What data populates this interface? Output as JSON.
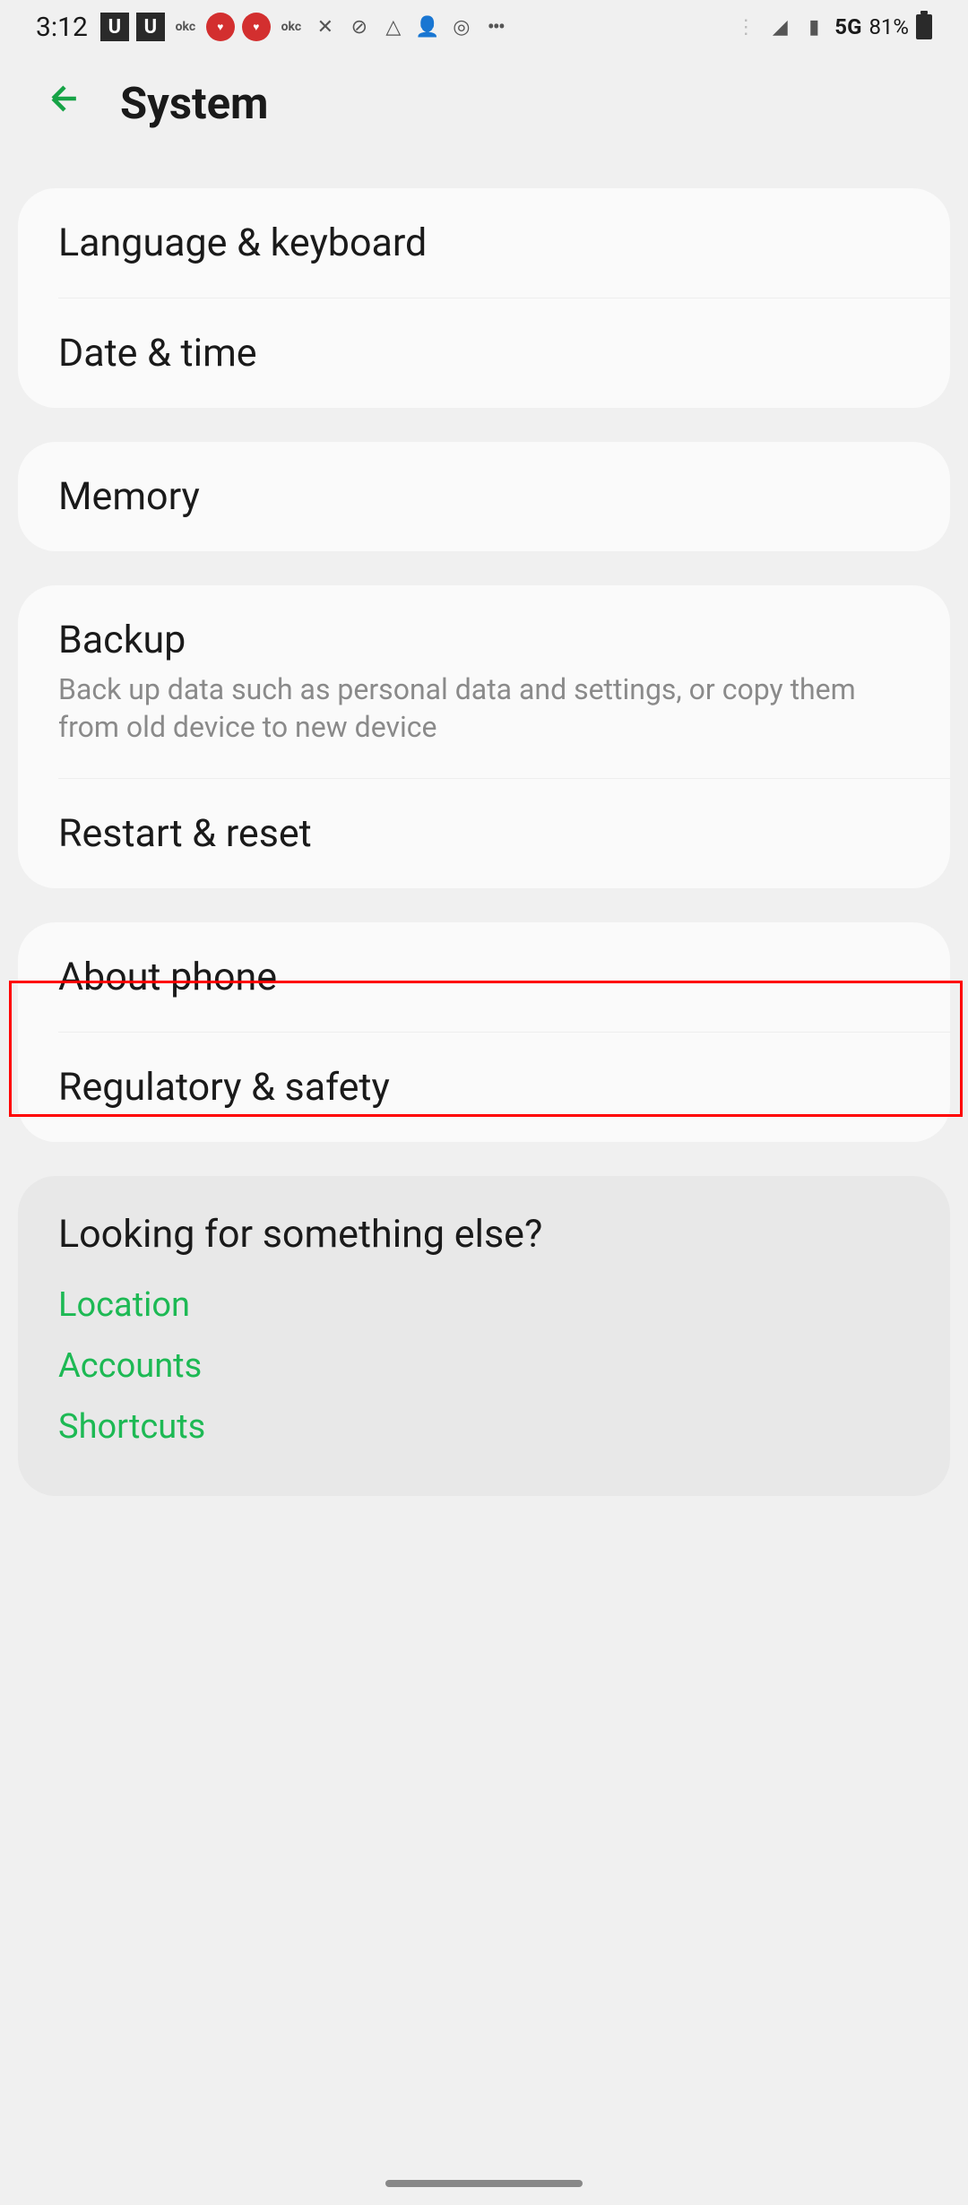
{
  "status": {
    "time": "3:12",
    "network": "5G",
    "battery": "81%"
  },
  "header": {
    "title": "System"
  },
  "items": {
    "language_keyboard": "Language & keyboard",
    "date_time": "Date & time",
    "memory": "Memory",
    "backup": {
      "title": "Backup",
      "subtitle": "Back up data such as personal data and settings, or copy them from old device to new device"
    },
    "restart_reset": "Restart & reset",
    "about_phone": "About phone",
    "regulatory_safety": "Regulatory & safety"
  },
  "suggestions": {
    "title": "Looking for something else?",
    "links": {
      "location": "Location",
      "accounts": "Accounts",
      "shortcuts": "Shortcuts"
    }
  }
}
